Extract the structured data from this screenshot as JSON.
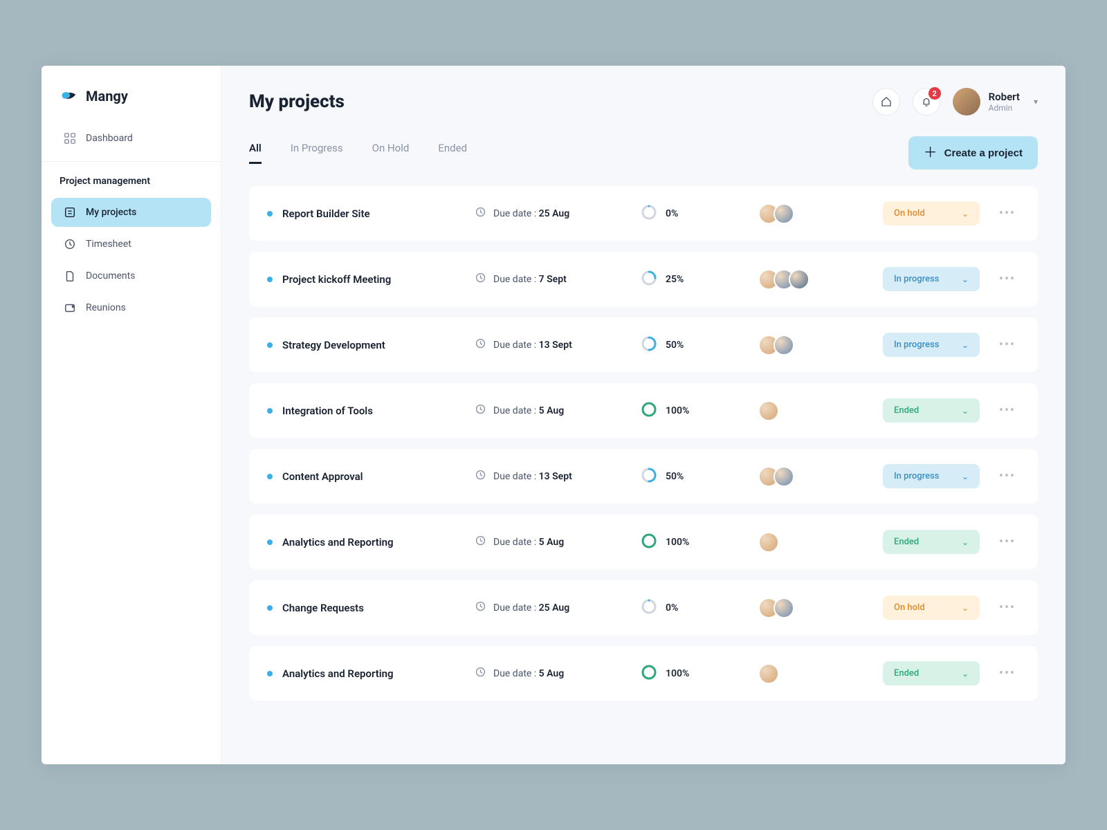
{
  "brand": "Mangy",
  "nav": {
    "dashboard": "Dashboard",
    "section_label": "Project management",
    "items": [
      {
        "label": "My projects",
        "active": true
      },
      {
        "label": "Timesheet",
        "active": false
      },
      {
        "label": "Documents",
        "active": false
      },
      {
        "label": "Reunions",
        "active": false
      }
    ]
  },
  "header": {
    "title": "My projects",
    "notification_count": "2",
    "user_name": "Robert",
    "user_role": "Admin"
  },
  "tabs": [
    {
      "label": "All",
      "active": true
    },
    {
      "label": "In Progress",
      "active": false
    },
    {
      "label": "On Hold",
      "active": false
    },
    {
      "label": "Ended",
      "active": false
    }
  ],
  "create_button": "Create a project",
  "due_prefix": "Due date : ",
  "projects": [
    {
      "name": "Report Builder Site",
      "due": "25 Aug",
      "progress": 0,
      "avatars": 2,
      "status": "On hold",
      "status_kind": "onhold"
    },
    {
      "name": "Project kickoff Meeting",
      "due": "7 Sept",
      "progress": 25,
      "avatars": 3,
      "status": "In  progress",
      "status_kind": "inprogress"
    },
    {
      "name": "Strategy Development",
      "due": "13 Sept",
      "progress": 50,
      "avatars": 2,
      "status": "In  progress",
      "status_kind": "inprogress"
    },
    {
      "name": "Integration of Tools",
      "due": "5 Aug",
      "progress": 100,
      "avatars": 1,
      "status": "Ended",
      "status_kind": "ended"
    },
    {
      "name": "Content Approval",
      "due": "13 Sept",
      "progress": 50,
      "avatars": 2,
      "status": "In  progress",
      "status_kind": "inprogress"
    },
    {
      "name": "Analytics and Reporting",
      "due": "5 Aug",
      "progress": 100,
      "avatars": 1,
      "status": "Ended",
      "status_kind": "ended"
    },
    {
      "name": "Change Requests",
      "due": "25 Aug",
      "progress": 0,
      "avatars": 2,
      "status": "On hold",
      "status_kind": "onhold"
    },
    {
      "name": "Analytics and Reporting",
      "due": "5 Aug",
      "progress": 100,
      "avatars": 1,
      "status": "Ended",
      "status_kind": "ended"
    }
  ],
  "avatar_colors": [
    "#d4a574",
    "#6c8cb0",
    "#4a6c8c"
  ],
  "ring_colors": {
    "default": "#3ab0e6",
    "complete": "#2ea87a",
    "empty": "#d0d6df"
  }
}
